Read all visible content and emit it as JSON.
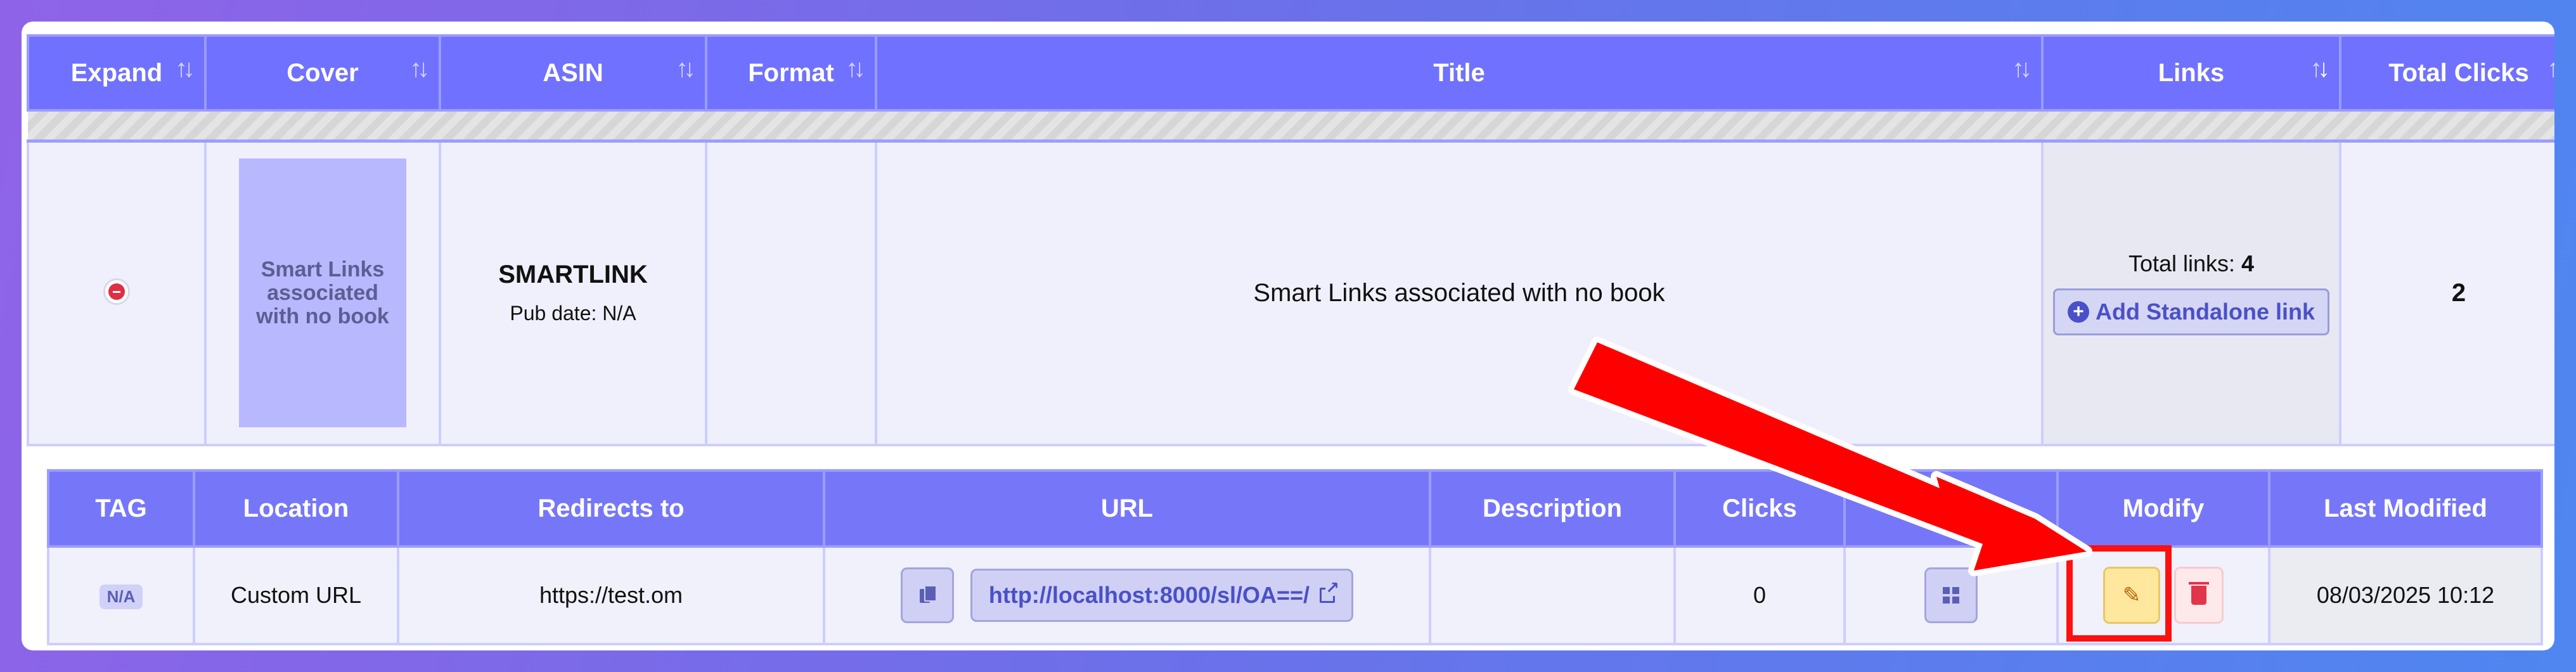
{
  "main_table": {
    "headers": [
      "Expand",
      "Cover",
      "ASIN",
      "Format",
      "Title",
      "Links",
      "Total Clicks"
    ],
    "row": {
      "cover_text": "Smart Links associated with no book",
      "asin": "SMARTLINK",
      "pub_date": "Pub date: N/A",
      "format": "",
      "title": "Smart Links associated with no book",
      "total_links_label": "Total links:",
      "total_links_value": "4",
      "add_link_label": "Add Standalone link",
      "total_clicks": "2"
    }
  },
  "links_table": {
    "headers": [
      "TAG",
      "Location",
      "Redirects to",
      "URL",
      "Description",
      "Clicks",
      "",
      "Modify",
      "Last Modified"
    ],
    "rows": [
      {
        "tag": "N/A",
        "location": "Custom URL",
        "redirects_to": "https://test.om",
        "url": "http://localhost:8000/sl/OA==/",
        "description": "",
        "clicks": "0",
        "last_modified": "08/03/2025 10:12"
      }
    ]
  },
  "annotation": {
    "arrow_color": "#ff0000",
    "highlight_color": "#ff1010"
  },
  "icons": {
    "edit": "edit-icon",
    "delete": "trash-icon",
    "qr": "qr-code-icon",
    "copy": "copy-icon",
    "external": "external-link-icon"
  }
}
